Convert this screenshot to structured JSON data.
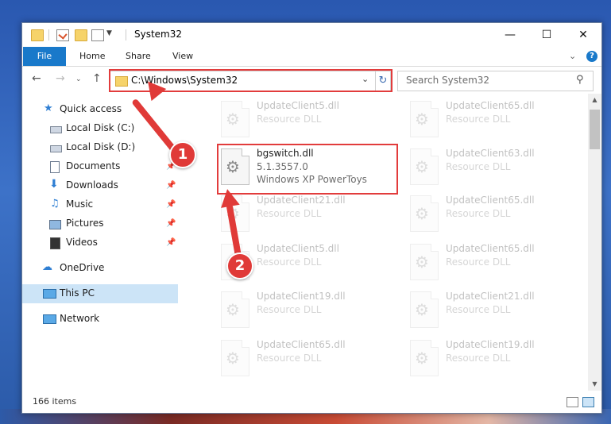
{
  "window": {
    "title": "System32",
    "controls": {
      "minimize": "—",
      "maximize": "☐",
      "close": "✕"
    }
  },
  "ribbon": {
    "tabs": [
      "File",
      "Home",
      "Share",
      "View"
    ],
    "help": "?"
  },
  "navigation": {
    "address": "C:\\Windows\\System32",
    "search_placeholder": "Search System32"
  },
  "sidebar": {
    "items": [
      {
        "label": "Quick access",
        "icon": "star-icon"
      },
      {
        "label": "Local Disk (C:)",
        "icon": "drive-icon"
      },
      {
        "label": "Local Disk (D:)",
        "icon": "drive-icon"
      },
      {
        "label": "Documents",
        "icon": "documents-icon",
        "pinned": true
      },
      {
        "label": "Downloads",
        "icon": "download-arrow-icon",
        "pinned": true
      },
      {
        "label": "Music",
        "icon": "music-note-icon",
        "pinned": true
      },
      {
        "label": "Pictures",
        "icon": "pictures-icon",
        "pinned": true
      },
      {
        "label": "Videos",
        "icon": "film-icon",
        "pinned": true
      },
      {
        "label": "OneDrive",
        "icon": "cloud-icon"
      },
      {
        "label": "This PC",
        "icon": "monitor-icon",
        "selected": true
      },
      {
        "label": "Network",
        "icon": "network-icon"
      }
    ]
  },
  "files": {
    "left_column": [
      {
        "name": "UpdateClient5.dll",
        "type": "Resource DLL"
      },
      {
        "name": "bgswitch.dll",
        "version": "5.1.3557.0",
        "company": "Windows XP PowerToys"
      },
      {
        "name": "UpdateClient21.dll",
        "type": "Resource DLL"
      },
      {
        "name": "UpdateClient5.dll",
        "type": "Resource DLL"
      },
      {
        "name": "UpdateClient19.dll",
        "type": "Resource DLL"
      },
      {
        "name": "UpdateClient65.dll",
        "type": "Resource DLL"
      }
    ],
    "right_column": [
      {
        "name": "UpdateClient65.dll",
        "type": "Resource DLL"
      },
      {
        "name": "UpdateClient63.dll",
        "type": "Resource DLL"
      },
      {
        "name": "UpdateClient65.dll",
        "type": "Resource DLL"
      },
      {
        "name": "UpdateClient65.dll",
        "type": "Resource DLL"
      },
      {
        "name": "UpdateClient21.dll",
        "type": "Resource DLL"
      },
      {
        "name": "UpdateClient19.dll",
        "type": "Resource DLL"
      }
    ]
  },
  "status": {
    "item_count": "166 items"
  },
  "callouts": {
    "step1": "1",
    "step2": "2"
  },
  "colors": {
    "accent": "#1979ca",
    "highlight": "#e23c3c",
    "selection": "#cce4f7"
  }
}
